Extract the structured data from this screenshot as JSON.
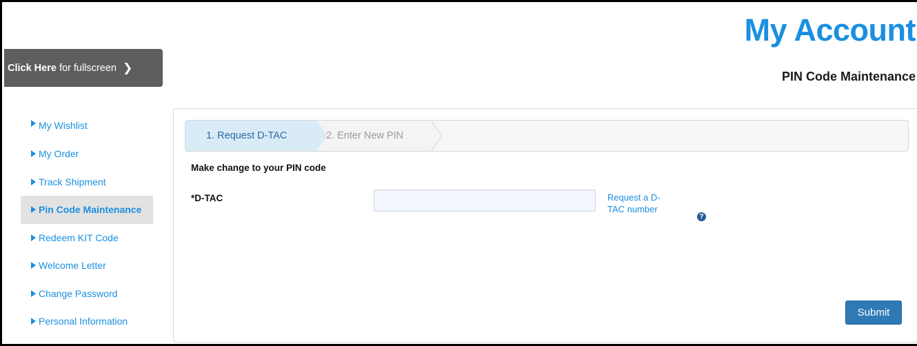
{
  "header": {
    "title": "My Account",
    "subtitle": "PIN Code Maintenance"
  },
  "fullscreen": {
    "strong": "Click Here",
    "rest": "for fullscreen"
  },
  "sidebar": {
    "items": [
      {
        "label": "My Wishlist",
        "active": false
      },
      {
        "label": "My Order",
        "active": false
      },
      {
        "label": "Track Shipment",
        "active": false
      },
      {
        "label": "Pin Code Maintenance",
        "active": true
      },
      {
        "label": "Redeem KIT Code",
        "active": false
      },
      {
        "label": "Welcome Letter",
        "active": false
      },
      {
        "label": "Change Password",
        "active": false
      },
      {
        "label": "Personal Information",
        "active": false
      }
    ]
  },
  "steps": [
    {
      "label": "1. Request D-TAC",
      "active": true
    },
    {
      "label": "2. Enter New PIN",
      "active": false
    }
  ],
  "form": {
    "section_title": "Make change to your PIN code",
    "dtac_label": "*D-TAC",
    "dtac_value": "",
    "request_link": "Request a D-TAC number",
    "help_icon": "question-circle-icon",
    "submit_label": "Submit"
  },
  "colors": {
    "accent": "#1a8fe0",
    "active_step_bg": "#d9ebf7",
    "submit_bg": "#2f7ab5",
    "fullscreen_bg": "#5e5e5e"
  }
}
